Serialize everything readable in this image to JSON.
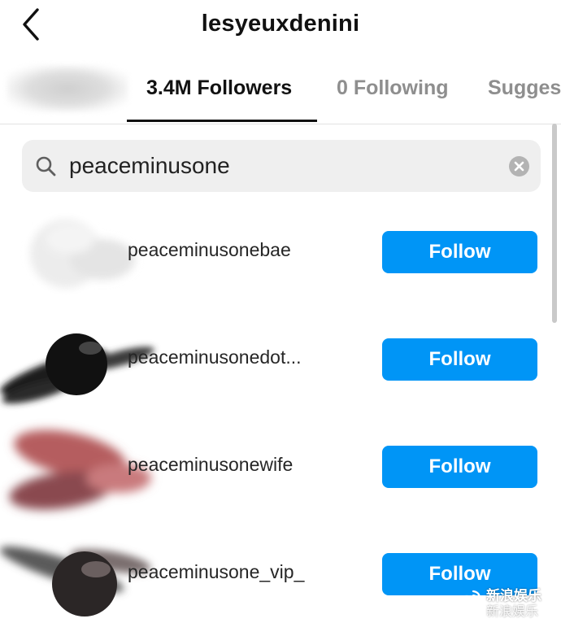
{
  "header": {
    "title": "lesyeuxdenini",
    "back_icon": "chevron-left-icon"
  },
  "tabs": [
    {
      "label": "3.4M Followers",
      "active": true
    },
    {
      "label": "0 Following",
      "active": false
    },
    {
      "label": "Sugges",
      "active": false
    }
  ],
  "search": {
    "value": "peaceminusone",
    "search_icon": "search-icon",
    "clear_icon": "clear-icon"
  },
  "results": [
    {
      "username": "peaceminusonebae",
      "button_label": "Follow"
    },
    {
      "username": "peaceminusonedot...",
      "button_label": "Follow"
    },
    {
      "username": "peaceminusonewife",
      "button_label": "Follow"
    },
    {
      "username": "peaceminusone_vip_",
      "button_label": "Follow"
    }
  ],
  "watermark": {
    "line1": "新浪娱乐",
    "line2": "新浪娱乐"
  },
  "colors": {
    "follow_button": "#0095f6",
    "search_bg": "#efefef",
    "inactive_tab": "#8e8e8e"
  }
}
